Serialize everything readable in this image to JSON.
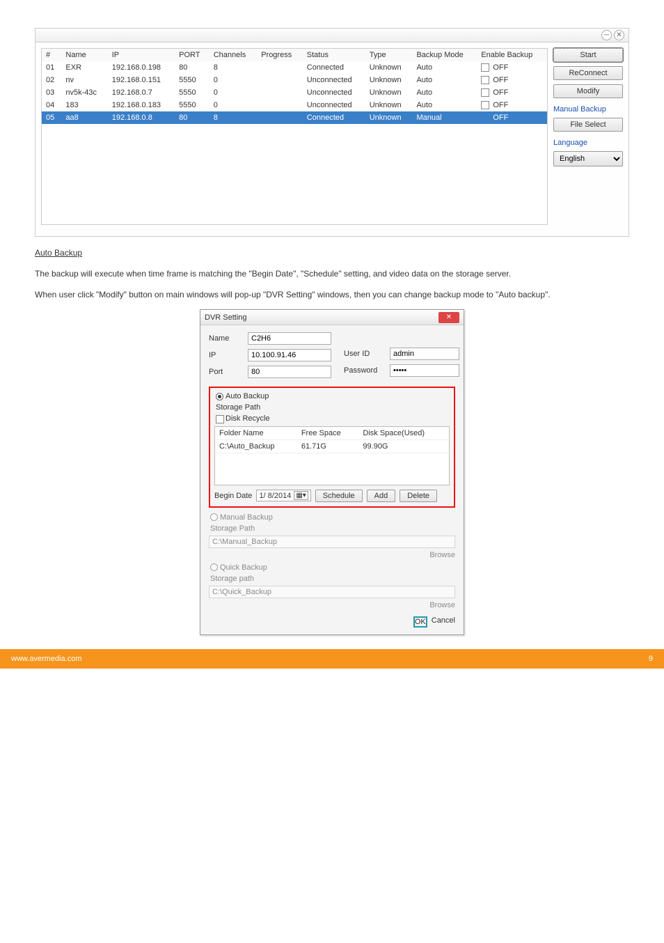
{
  "doc": {
    "underline_heading": "Auto Backup",
    "p1": "The backup will execute when time frame is matching the \"Begin Date\", \"Schedule\" setting, and video data on the storage server.",
    "p2": "When user click \"Modify\" button on main windows will pop-up \"DVR Setting\" windows, then you can change backup mode to \"Auto backup\"."
  },
  "list_window": {
    "columns": [
      "#",
      "Name",
      "IP",
      "PORT",
      "Channels",
      "Progress",
      "Status",
      "Type",
      "Backup Mode",
      "Enable Backup"
    ],
    "rows": [
      {
        "n": "01",
        "name": "EXR",
        "ip": "192.168.0.198",
        "port": "80",
        "channels": "8",
        "progress": "",
        "status": "Connected",
        "type": "Unknown",
        "mode": "Auto",
        "enable": "OFF"
      },
      {
        "n": "02",
        "name": "nv",
        "ip": "192.168.0.151",
        "port": "5550",
        "channels": "0",
        "progress": "",
        "status": "Unconnected",
        "type": "Unknown",
        "mode": "Auto",
        "enable": "OFF"
      },
      {
        "n": "03",
        "name": "nv5k-43c",
        "ip": "192.168.0.7",
        "port": "5550",
        "channels": "0",
        "progress": "",
        "status": "Unconnected",
        "type": "Unknown",
        "mode": "Auto",
        "enable": "OFF"
      },
      {
        "n": "04",
        "name": "183",
        "ip": "192.168.0.183",
        "port": "5550",
        "channels": "0",
        "progress": "",
        "status": "Unconnected",
        "type": "Unknown",
        "mode": "Auto",
        "enable": "OFF"
      },
      {
        "n": "05",
        "name": "aa8",
        "ip": "192.168.0.8",
        "port": "80",
        "channels": "8",
        "progress": "",
        "status": "Connected",
        "type": "Unknown",
        "mode": "Manual",
        "enable": "OFF",
        "selected": true
      }
    ],
    "side": {
      "start": "Start",
      "reconnect": "ReConnect",
      "modify": "Modify",
      "manual_backup": "Manual Backup",
      "file_select": "File Select",
      "language": "Language",
      "lang_value": "English"
    }
  },
  "dialog": {
    "title": "DVR Setting",
    "name_label": "Name",
    "name_val": "C2H6",
    "ip_label": "IP",
    "ip_val": "10.100.91.46",
    "port_label": "Port",
    "port_val": "80",
    "user_label": "User ID",
    "user_val": "admin",
    "pwd_label": "Password",
    "pwd_val": "•••••",
    "auto": {
      "radio": "Auto Backup",
      "storage": "Storage Path",
      "disk_recycle": "Disk Recycle",
      "col1": "Folder Name",
      "col2": "Free Space",
      "col3": "Disk Space(Used)",
      "row_folder": "C:\\Auto_Backup",
      "row_free": "61.71G",
      "row_used": "99.90G",
      "begin": "Begin Date",
      "date": "1/ 8/2014",
      "schedule": "Schedule",
      "add": "Add",
      "delete": "Delete"
    },
    "manual": {
      "radio": "Manual Backup",
      "storage": "Storage Path",
      "path": "C:\\Manual_Backup",
      "browse": "Browse"
    },
    "quick": {
      "radio": "Quick Backup",
      "storage": "Storage path",
      "path": "C:\\Quick_Backup",
      "browse": "Browse"
    },
    "ok": "OK",
    "cancel": "Cancel"
  },
  "footer": {
    "left": "www.avermedia.com",
    "right": "9"
  }
}
